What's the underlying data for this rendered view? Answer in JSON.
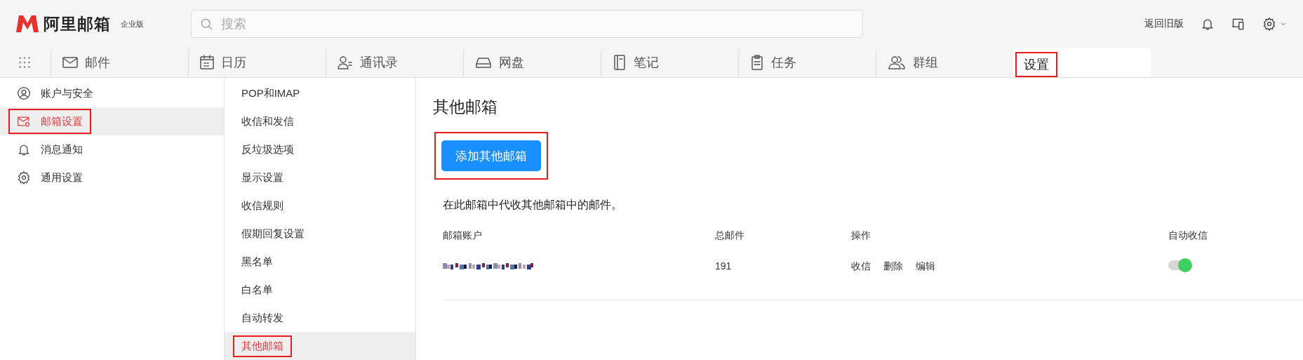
{
  "brand": {
    "name": "阿里邮箱",
    "edition": "企业版"
  },
  "search": {
    "placeholder": "搜索"
  },
  "header_link": "返回旧版",
  "tabs": [
    {
      "kind": "mail",
      "label": "邮件",
      "selected": false,
      "highlighted": false
    },
    {
      "kind": "calendar",
      "label": "日历",
      "selected": false,
      "highlighted": false
    },
    {
      "kind": "contacts",
      "label": "通讯录",
      "selected": false,
      "highlighted": false
    },
    {
      "kind": "drive",
      "label": "网盘",
      "selected": false,
      "highlighted": false
    },
    {
      "kind": "notes",
      "label": "笔记",
      "selected": false,
      "highlighted": false
    },
    {
      "kind": "tasks",
      "label": "任务",
      "selected": false,
      "highlighted": false
    },
    {
      "kind": "groups",
      "label": "群组",
      "selected": false,
      "highlighted": false
    },
    {
      "kind": "none",
      "label": "设置",
      "selected": true,
      "highlighted": true
    }
  ],
  "sidebar": {
    "items": [
      {
        "kind": "account",
        "label": "账户与安全",
        "selected": false,
        "highlighted": false
      },
      {
        "kind": "mailbox",
        "label": "邮箱设置",
        "selected": true,
        "highlighted": true
      },
      {
        "kind": "notify",
        "label": "消息通知",
        "selected": false,
        "highlighted": false
      },
      {
        "kind": "general",
        "label": "通用设置",
        "selected": false,
        "highlighted": false
      }
    ]
  },
  "submenu": {
    "items": [
      {
        "label": "POP和IMAP",
        "selected": false,
        "highlighted": false
      },
      {
        "label": "收信和发信",
        "selected": false,
        "highlighted": false
      },
      {
        "label": "反垃圾选项",
        "selected": false,
        "highlighted": false
      },
      {
        "label": "显示设置",
        "selected": false,
        "highlighted": false
      },
      {
        "label": "收信规则",
        "selected": false,
        "highlighted": false
      },
      {
        "label": "假期回复设置",
        "selected": false,
        "highlighted": false
      },
      {
        "label": "黑名单",
        "selected": false,
        "highlighted": false
      },
      {
        "label": "白名单",
        "selected": false,
        "highlighted": false
      },
      {
        "label": "自动转发",
        "selected": false,
        "highlighted": false
      },
      {
        "label": "其他邮箱",
        "selected": true,
        "highlighted": true
      }
    ]
  },
  "content": {
    "title": "其他邮箱",
    "add_button": {
      "label": "添加其他邮箱",
      "highlighted": true
    },
    "description": "在此邮箱中代收其他邮箱中的邮件。",
    "table": {
      "columns": [
        "邮箱账户",
        "总邮件",
        "操作",
        "自动收信"
      ],
      "rows": [
        {
          "account": {
            "kind": "redacted"
          },
          "total": "191",
          "actions": [
            "收信",
            "删除",
            "编辑"
          ],
          "auto_receive": {
            "on": true
          }
        }
      ]
    }
  }
}
